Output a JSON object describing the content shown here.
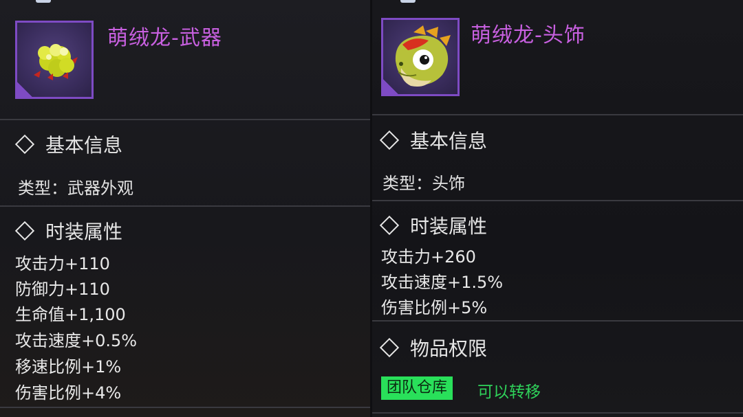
{
  "left_card": {
    "title": "萌绒龙-武器",
    "icon": "yellow-weapon-blob-icon",
    "basic_info_header": "基本信息",
    "type_line": "类型：武器外观",
    "attr_header": "时装属性",
    "stats": [
      "攻击力+110",
      "防御力+110",
      "生命值+1,100",
      "攻击速度+0.5%",
      "移速比例+1%",
      "伤害比例+4%"
    ]
  },
  "right_card": {
    "title": "萌绒龙-头饰",
    "icon": "dragon-head-icon",
    "basic_info_header": "基本信息",
    "type_line": "类型：头饰",
    "attr_header": "时装属性",
    "stats": [
      "攻击力+260",
      "攻击速度+1.5%",
      "伤害比例+5%"
    ],
    "perm_header": "物品权限",
    "perm_badge": "团队仓库",
    "perm_text": "可以转移"
  },
  "colors": {
    "title": "#c860e0",
    "frame": "#7e4bc4",
    "badge_bg": "#29e05a",
    "perm_text": "#2fd25a"
  }
}
